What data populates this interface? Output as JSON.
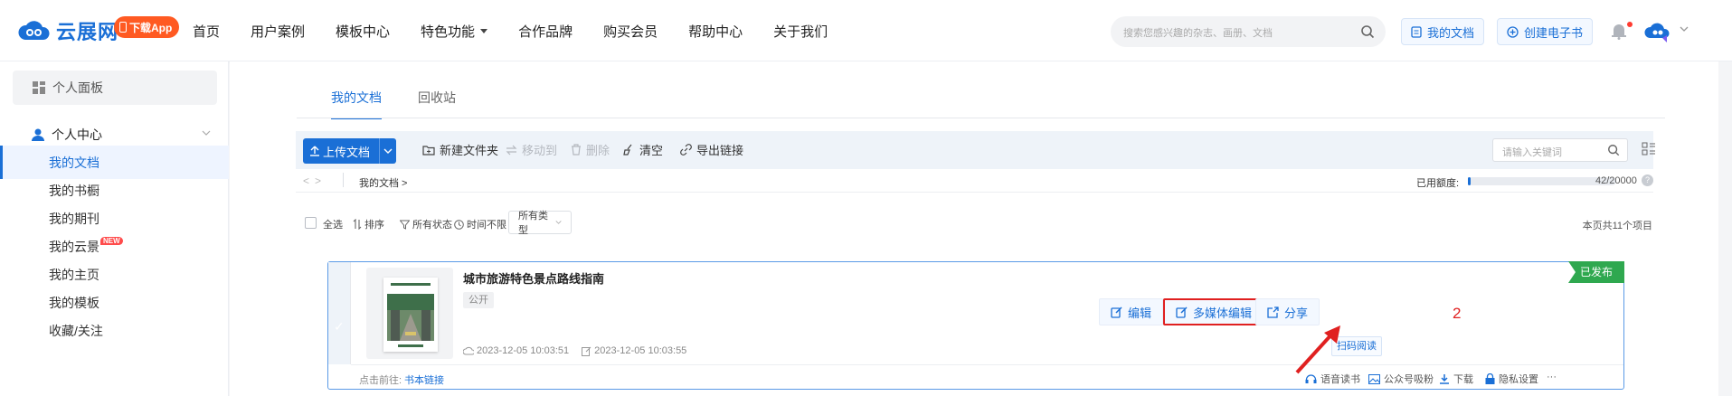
{
  "header": {
    "logo_text": "云展网",
    "app_button": "下载App",
    "nav": [
      "首页",
      "用户案例",
      "模板中心",
      "特色功能",
      "合作品牌",
      "购买会员",
      "帮助中心",
      "关于我们"
    ],
    "search_placeholder": "搜索您感兴趣的杂志、画册、文档",
    "my_docs_button": "我的文档",
    "create_button": "创建电子书"
  },
  "sidebar": {
    "panel": "个人面板",
    "group": "个人中心",
    "items": [
      {
        "label": "我的文档",
        "active": true
      },
      {
        "label": "我的书橱"
      },
      {
        "label": "我的期刊"
      },
      {
        "label": "我的云景",
        "badge": "NEW"
      },
      {
        "label": "我的主页"
      },
      {
        "label": "我的模板"
      },
      {
        "label": "收藏/关注"
      }
    ]
  },
  "main": {
    "tabs": [
      "我的文档",
      "回收站"
    ],
    "toolbar": {
      "upload": "上传文档",
      "new_folder": "新建文件夹",
      "move_to": "移动到",
      "delete": "删除",
      "clear": "清空",
      "export_link": "导出链接",
      "keyword_placeholder": "请输入关键词"
    },
    "path": {
      "crumb": "我的文档 >",
      "quota_label": "已用额度:",
      "quota_text": "42/20000",
      "quota_fraction": 0.0021
    },
    "filters": {
      "select_all": "全选",
      "sort": "排序",
      "status": "所有状态",
      "time": "时间不限",
      "type": "所有类型",
      "count": "本页共11个项目"
    },
    "document": {
      "title": "城市旅游特色景点路线指南",
      "visibility": "公开",
      "created": "2023-12-05 10:03:51",
      "modified": "2023-12-05 10:03:55",
      "status": "已发布",
      "actions": [
        "编辑",
        "多媒体编辑",
        "分享"
      ],
      "scan": "扫码阅读",
      "goto_label": "点击前往:",
      "goto_link": "书本链接",
      "footer_actions": [
        "语音读书",
        "公众号吸粉",
        "下载",
        "隐私设置",
        "···"
      ]
    },
    "annotation": "2"
  },
  "colors": {
    "brand": "#1a6fd6",
    "published": "#2fa84f",
    "highlight": "#e02020",
    "app_button": "#ff5a22"
  }
}
